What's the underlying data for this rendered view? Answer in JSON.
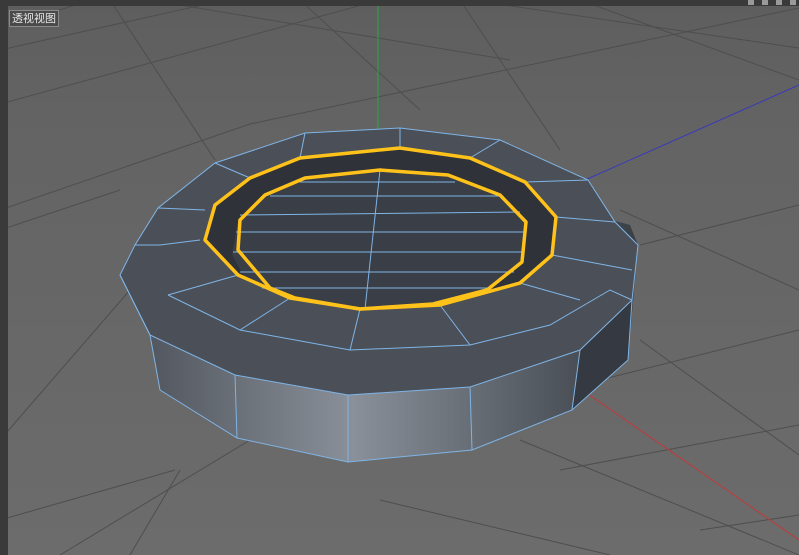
{
  "viewport": {
    "label": "透视视图",
    "background_color": "#646464",
    "grid_color": "#4f4f4f",
    "axis_y_color": "#2aa83a",
    "axis_x_color": "#c23a3a",
    "axis_z_color": "#3a3ab8"
  },
  "model": {
    "shape": "cylinder-ring",
    "wireframe_color": "#7fb4e6",
    "selection_color": "#ffc21a",
    "face_color": "#4b5058"
  }
}
